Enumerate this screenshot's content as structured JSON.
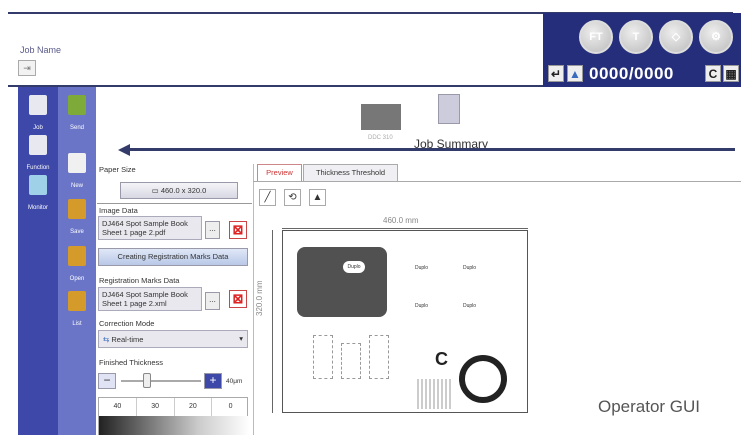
{
  "header": {
    "job_name_label": "Job Name",
    "job_name_value": "",
    "status_buttons": [
      "FT",
      "T",
      "",
      ""
    ],
    "counter": "0000/0000",
    "c_button": "C"
  },
  "nav": {
    "primary": [
      {
        "label": "Job"
      },
      {
        "label": "Function"
      },
      {
        "label": "Monitor"
      }
    ],
    "secondary": [
      {
        "label": "Send"
      },
      {
        "label": "New"
      },
      {
        "label": "Save"
      },
      {
        "label": "Open"
      },
      {
        "label": "List"
      }
    ]
  },
  "job_summary": {
    "folder_label": "DDC 310",
    "title": "Job Summary"
  },
  "params": {
    "paper_size_label": "Paper Size",
    "paper_size_value": "460.0 x 320.0",
    "image_data_label": "Image Data",
    "image_data_value_line1": "DJ464 Spot Sample Book",
    "image_data_value_line2": "Sheet 1 page 2.pdf",
    "create_reg_button": "Creating Registration Marks Data",
    "reg_marks_label": "Registration Marks Data",
    "reg_marks_value_line1": "DJ464 Spot Sample Book",
    "reg_marks_value_line2": "Sheet 1 page 2.xml",
    "correction_label": "Correction Mode",
    "correction_value": "Real-time",
    "thickness_label": "Finished Thickness",
    "thickness_value": "40μm",
    "thickness_levels": [
      "40",
      "30",
      "20",
      "0"
    ],
    "more_button": "..."
  },
  "tabs": [
    "Preview",
    "Thickness Threshold"
  ],
  "preview": {
    "width_label": "460.0 mm",
    "height_label": "320.0 mm",
    "sample_labels": [
      "Duplo",
      "Duplo",
      "Duplo",
      "Duplo",
      "Duplo"
    ]
  },
  "caption": "Operator GUI",
  "colors": {
    "nav_primary": "#3d48a8",
    "nav_secondary": "#6a75c8",
    "status_panel": "#252e7a",
    "danger": "#d22222"
  }
}
